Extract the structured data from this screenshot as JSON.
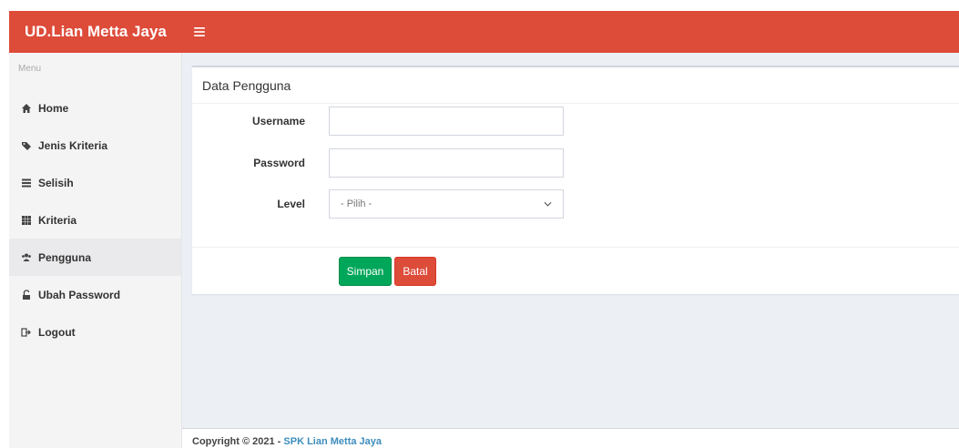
{
  "brand": {
    "title": "UD.Lian Metta Jaya",
    "toggle_icon": "bars-icon"
  },
  "sidebar": {
    "header": "Menu",
    "items": [
      {
        "label": "Home",
        "icon": "home-icon"
      },
      {
        "label": "Jenis Kriteria",
        "icon": "tags-icon"
      },
      {
        "label": "Selisih",
        "icon": "list-icon"
      },
      {
        "label": "Kriteria",
        "icon": "grid-icon"
      },
      {
        "label": "Pengguna",
        "icon": "users-icon",
        "active": true
      },
      {
        "label": "Ubah Password",
        "icon": "unlock-icon"
      },
      {
        "label": "Logout",
        "icon": "logout-icon"
      }
    ]
  },
  "panel": {
    "title": "Data Pengguna",
    "fields": {
      "username_label": "Username",
      "username_value": "",
      "password_label": "Password",
      "password_value": "",
      "level_label": "Level",
      "level_selected": "- Pilih -"
    },
    "buttons": {
      "save": "Simpan",
      "cancel": "Batal"
    }
  },
  "footer": {
    "prefix": "Copyright © 2021 - ",
    "link": "SPK Lian Metta Jaya"
  },
  "colors": {
    "header": "#dd4b39",
    "save": "#00a65a",
    "cancel": "#dd4b39",
    "link": "#3c8dbc"
  }
}
